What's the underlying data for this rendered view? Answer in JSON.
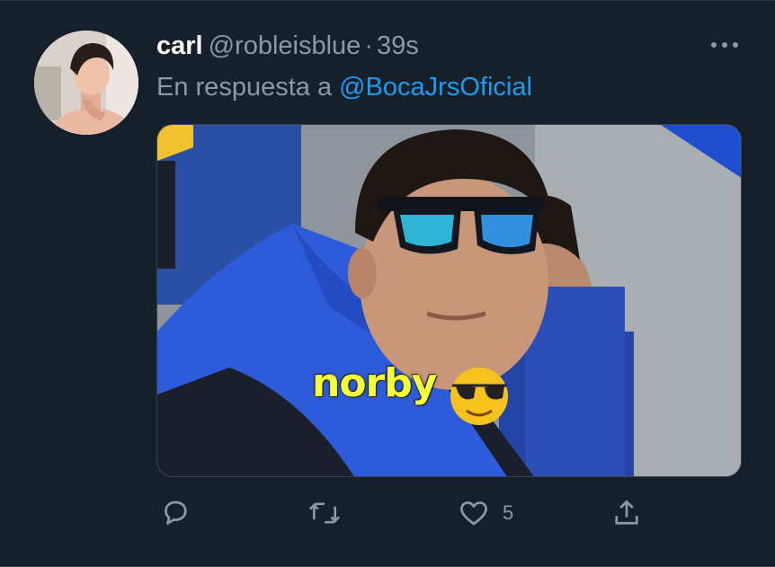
{
  "tweet": {
    "display_name": "carl",
    "handle": "@robleisblue",
    "separator": "·",
    "time": "39s",
    "reply_prefix": "En respuesta a",
    "reply_mention": "@BocaJrsOficial",
    "media": {
      "caption": "norby",
      "emoji_icon": "smiling-face-with-sunglasses-icon"
    },
    "actions": {
      "reply_icon": "comment-icon",
      "retweet_icon": "retweet-icon",
      "like_icon": "heart-icon",
      "like_count": "5",
      "share_icon": "share-icon"
    }
  },
  "colors": {
    "background": "#15202b",
    "link": "#1d9bf0",
    "secondary_text": "#8b98a5",
    "primary_text": "#ffffff"
  }
}
